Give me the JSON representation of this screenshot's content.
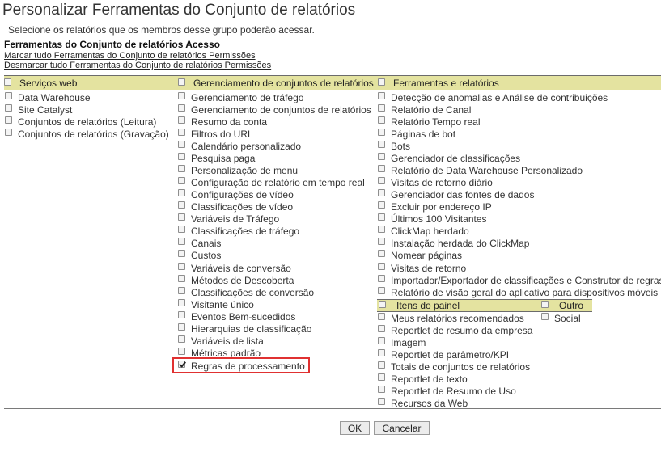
{
  "page": {
    "title": "Personalizar Ferramentas do Conjunto de relatórios",
    "subtitle": "Selecione os relatórios que os membros desse grupo poderão acessar.",
    "section_label": "Ferramentas do Conjunto de relatórios Acesso",
    "link_select_all": "Marcar tudo Ferramentas do Conjunto de relatórios Permissões",
    "link_deselect_all": "Desmarcar tudo Ferramentas do Conjunto de relatórios Permissões"
  },
  "columns": [
    {
      "header": "Serviços web",
      "items": [
        {
          "label": "Data Warehouse",
          "checked": false
        },
        {
          "label": "Site Catalyst",
          "checked": false
        },
        {
          "label": "Conjuntos de relatórios (Leitura)",
          "checked": false
        },
        {
          "label": "Conjuntos de relatórios (Gravação)",
          "checked": false
        }
      ]
    },
    {
      "header": "Gerenciamento de conjuntos de relatórios",
      "items": [
        {
          "label": "Gerenciamento de tráfego",
          "checked": false
        },
        {
          "label": "Gerenciamento de conjuntos de relatórios",
          "checked": false
        },
        {
          "label": "Resumo da conta",
          "checked": false
        },
        {
          "label": "Filtros do URL",
          "checked": false
        },
        {
          "label": "Calendário personalizado",
          "checked": false
        },
        {
          "label": "Pesquisa paga",
          "checked": false
        },
        {
          "label": "Personalização de menu",
          "checked": false
        },
        {
          "label": "Configuração de relatório em tempo real",
          "checked": false
        },
        {
          "label": "Configurações de vídeo",
          "checked": false
        },
        {
          "label": "Classificações de vídeo",
          "checked": false
        },
        {
          "label": "Variáveis de Tráfego",
          "checked": false
        },
        {
          "label": "Classificações de tráfego",
          "checked": false
        },
        {
          "label": "Canais",
          "checked": false
        },
        {
          "label": "Custos",
          "checked": false
        },
        {
          "label": "Variáveis de conversão",
          "checked": false
        },
        {
          "label": "Métodos de Descoberta",
          "checked": false
        },
        {
          "label": "Classificações de conversão",
          "checked": false
        },
        {
          "label": "Visitante único",
          "checked": false
        },
        {
          "label": "Eventos Bem-sucedidos",
          "checked": false
        },
        {
          "label": "Hierarquias de classificação",
          "checked": false
        },
        {
          "label": "Variáveis de lista",
          "checked": false
        },
        {
          "label": "Métricas padrão",
          "checked": false
        },
        {
          "label": "Regras de processamento",
          "checked": true
        }
      ]
    },
    {
      "header": "Ferramentas e relatórios",
      "items": [
        {
          "label": "Detecção de anomalias e Análise de contribuições",
          "checked": false
        },
        {
          "label": "Relatório de Canal",
          "checked": false
        },
        {
          "label": "Relatório Tempo real",
          "checked": false
        },
        {
          "label": "Páginas de bot",
          "checked": false
        },
        {
          "label": "Bots",
          "checked": false
        },
        {
          "label": "Gerenciador de classificações",
          "checked": false
        },
        {
          "label": "Relatório de Data Warehouse Personalizado",
          "checked": false
        },
        {
          "label": "Visitas de retorno diário",
          "checked": false
        },
        {
          "label": "Gerenciador das fontes de dados",
          "checked": false
        },
        {
          "label": "Excluir por endereço IP",
          "checked": false
        },
        {
          "label": "Últimos 100 Visitantes",
          "checked": false
        },
        {
          "label": "ClickMap herdado",
          "checked": false
        },
        {
          "label": "Instalação herdada do ClickMap",
          "checked": false
        },
        {
          "label": "Nomear páginas",
          "checked": false
        },
        {
          "label": "Visitas de retorno",
          "checked": false
        },
        {
          "label": "Importador/Exportador de classificações e Construtor de regras",
          "checked": false
        },
        {
          "label": "Relatório de visão geral do aplicativo para dispositivos móveis",
          "checked": false
        }
      ]
    }
  ],
  "panel_items": {
    "header": "Itens do painel",
    "items": [
      {
        "label": "Meus relatórios recomendados",
        "checked": false
      },
      {
        "label": "Reportlet de resumo da empresa",
        "checked": false
      },
      {
        "label": "Imagem",
        "checked": false
      },
      {
        "label": "Reportlet de parâmetro/KPI",
        "checked": false
      },
      {
        "label": "Totais de conjuntos de relatórios",
        "checked": false
      },
      {
        "label": "Reportlet de texto",
        "checked": false
      },
      {
        "label": "Reportlet de Resumo de Uso",
        "checked": false
      },
      {
        "label": "Recursos da Web",
        "checked": false
      }
    ]
  },
  "other": {
    "header": "Outro",
    "items": [
      {
        "label": "Social",
        "checked": false
      }
    ]
  },
  "buttons": {
    "ok": "OK",
    "cancel": "Cancelar"
  },
  "colors": {
    "header_band": "#e4e3a0",
    "highlight": "#e03131"
  }
}
